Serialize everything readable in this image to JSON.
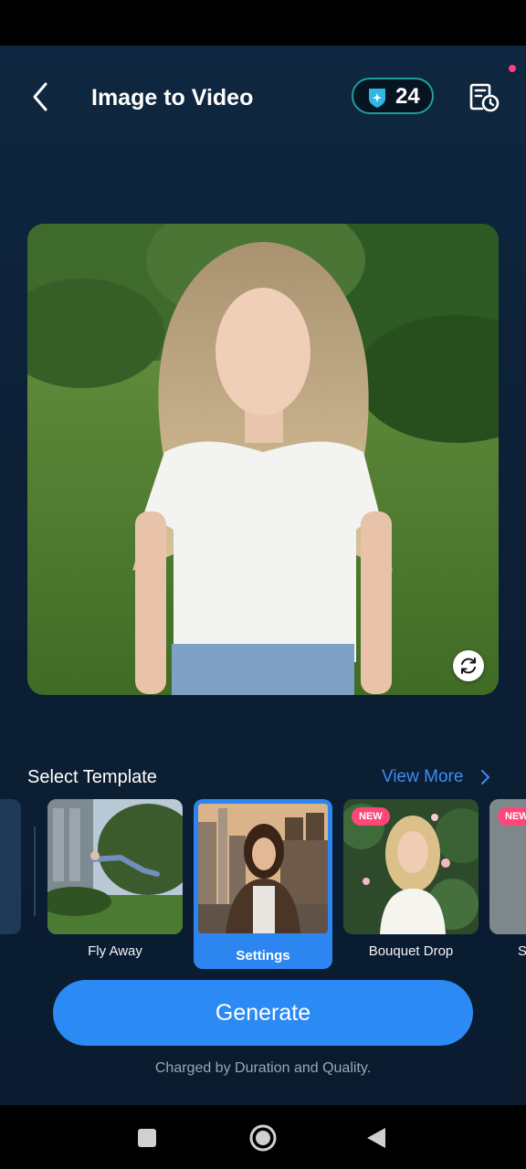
{
  "header": {
    "title": "Image to Video",
    "credits": "24"
  },
  "templates_section": {
    "title": "Select Template",
    "view_more": "View More"
  },
  "templates": [
    {
      "label": "Fly Away",
      "badge": "",
      "selected": false
    },
    {
      "label": "Settings",
      "badge": "",
      "selected": true
    },
    {
      "label": "Bouquet Drop",
      "badge": "NEW",
      "selected": false
    },
    {
      "label": "S",
      "badge": "NEW",
      "selected": false
    }
  ],
  "generate": {
    "label": "Generate",
    "hint": "Charged by Duration and Quality."
  },
  "colors": {
    "accent": "#2c8af5",
    "background": "#0b1e33",
    "badge": "#ff4679",
    "credits_border": "#1f9fa3"
  }
}
